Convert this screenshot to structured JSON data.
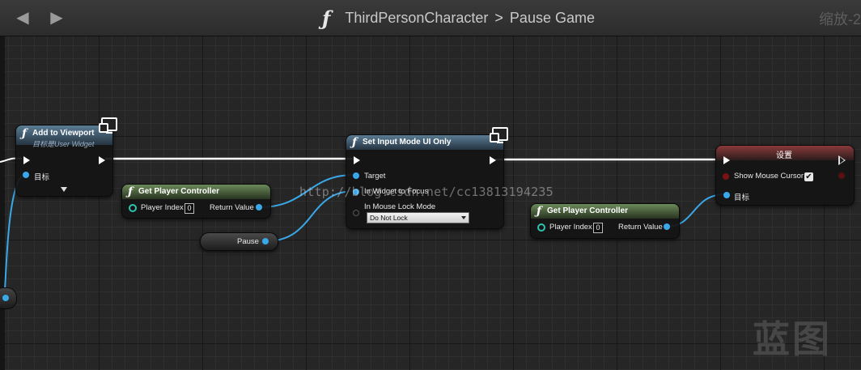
{
  "titlebar": {
    "back_icon": "arrow-left-icon",
    "forward_icon": "arrow-right-icon",
    "function_glyph": "ƒ",
    "graph_owner": "ThirdPersonCharacter",
    "separator": ">",
    "graph_name": "Pause Game",
    "zoom_label": "缩放-2"
  },
  "nodes": {
    "add_to_viewport": {
      "title": "Add to Viewport",
      "subtitle": "目标是User Widget",
      "target_label": "目标"
    },
    "get_player_controller_1": {
      "title": "Get Player Controller",
      "player_index_label": "Player Index",
      "player_index_value": "0",
      "return_value_label": "Return Value"
    },
    "pause_variable": {
      "label": "Pause"
    },
    "set_input_mode": {
      "title": "Set Input Mode UI Only",
      "target_label": "Target",
      "widget_to_focus_label": "In Widget to Focus",
      "mouse_lock_mode_label": "In Mouse Lock Mode",
      "mouse_lock_mode_value": "Do Not Lock"
    },
    "get_player_controller_2": {
      "title": "Get Player Controller",
      "player_index_label": "Player Index",
      "player_index_value": "0",
      "return_value_label": "Return Value"
    },
    "set_node": {
      "title": "设置",
      "show_mouse_cursor_label": "Show Mouse Cursor",
      "show_mouse_cursor_checked": true,
      "target_label": "目标"
    }
  },
  "watermarks": {
    "url": "http://blog.csdn.net/cc13813194235",
    "blueprint": "蓝图"
  },
  "colors": {
    "graph_background": "#262626",
    "exec_wire": "#ffffff",
    "object_wire": "#3aa8e8",
    "function_header_blue": "#5a7c94",
    "pure_function_header_green": "#6c8a5a",
    "variable_set_header_red": "#8a3a3a"
  }
}
